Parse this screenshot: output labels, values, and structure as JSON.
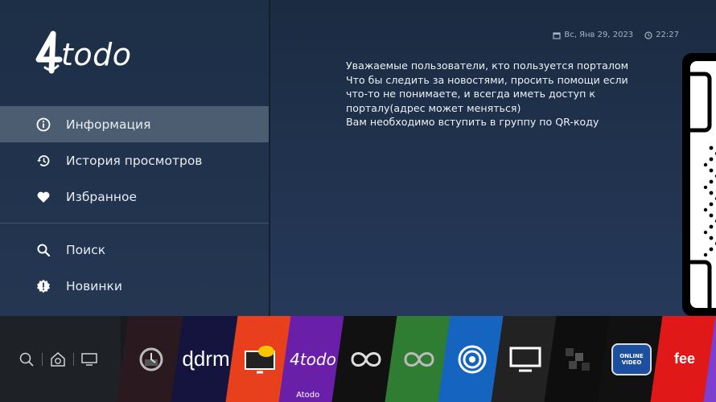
{
  "brand": {
    "logo_text": "todo",
    "logo_mark": "4"
  },
  "sidebar": {
    "menu_primary": [
      {
        "label": "Информация",
        "icon": "info-icon",
        "active": true
      },
      {
        "label": "История просмотров",
        "icon": "history-icon",
        "active": false
      },
      {
        "label": "Избранное",
        "icon": "heart-icon",
        "active": false
      }
    ],
    "menu_secondary": [
      {
        "label": "Поиск",
        "icon": "search-icon"
      },
      {
        "label": "Новинки",
        "icon": "new-badge-icon"
      }
    ]
  },
  "header": {
    "date": "Вс, Янв 29, 2023",
    "time": "22:27"
  },
  "message": {
    "lines": [
      "Уважаемые пользователи, кто пользуется порталом",
      "Что бы следить за новостями, просить помощи если",
      "что-то не понимаете, и всегда иметь доступ к",
      "порталу(адрес может меняться)",
      "Вам необходимо вступить в группу по QR-коду"
    ]
  },
  "launcher": {
    "left_buttons": [
      "search-icon",
      "home-settings-icon",
      "tv-input-icon"
    ],
    "tiles": [
      {
        "name": "recent-app",
        "color": "#2a1a1f"
      },
      {
        "name": "drm-play",
        "color": "#1a1a4a",
        "text": "drm"
      },
      {
        "name": "iptv-app",
        "color": "#e8401c"
      },
      {
        "name": "atodo-app",
        "color": "#6a1fa8",
        "text": "4todo",
        "label": "Atodo"
      },
      {
        "name": "infinity-app",
        "color": "#111111"
      },
      {
        "name": "infinity-green-app",
        "color": "#2e7d32"
      },
      {
        "name": "signal-app",
        "color": "#1565c0"
      },
      {
        "name": "tv-app",
        "color": "#222222"
      },
      {
        "name": "blurred-app",
        "color": "#0e0e0e"
      },
      {
        "name": "online-video-app",
        "color": "#111111",
        "text": "ONLINE VIDEO"
      },
      {
        "name": "fee-app",
        "color": "#e11818",
        "text": "fee"
      },
      {
        "name": "purple-app",
        "color": "#7d3fd0"
      }
    ]
  },
  "colors": {
    "active_item": "#4d5d71",
    "sidebar": "#1d2f47",
    "main": "#22344f",
    "accent_purple": "#6a1fa8"
  }
}
